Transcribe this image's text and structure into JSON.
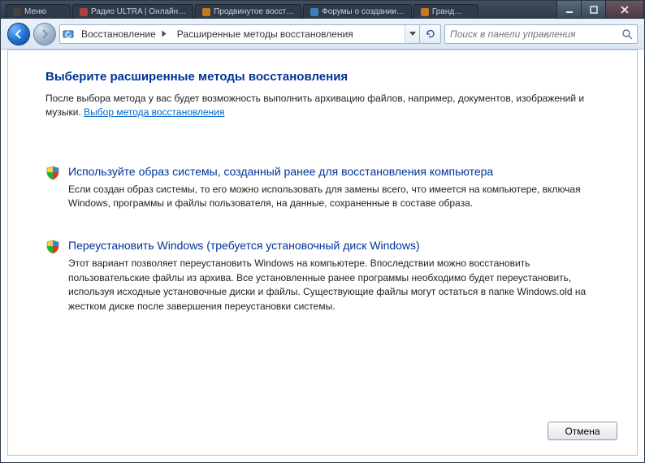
{
  "titlebar": {
    "tabs": [
      {
        "label": "Меню"
      },
      {
        "label": "Радио ULTRA | Онлайн…"
      },
      {
        "label": "Продвинутое восст…"
      },
      {
        "label": "Форумы о создании…"
      },
      {
        "label": "Гранд…"
      }
    ]
  },
  "nav": {
    "breadcrumb": [
      "Восстановление",
      "Расширенные методы восстановления"
    ],
    "search_placeholder": "Поиск в панели управления"
  },
  "page": {
    "title": "Выберите расширенные методы восстановления",
    "intro_prefix": "После выбора метода у вас будет возможность выполнить архивацию файлов, например, документов, изображений и музыки. ",
    "intro_link": "Выбор метода восстановления"
  },
  "options": [
    {
      "title": "Используйте образ системы, созданный ранее для восстановления компьютера",
      "desc": "Если создан образ системы, то его можно использовать для замены всего, что имеется на компьютере, включая Windows, программы и файлы пользователя, на данные, сохраненные в составе образа."
    },
    {
      "title": "Переустановить Windows (требуется установочный диск Windows)",
      "desc": "Этот вариант позволяет переустановить Windows на компьютере. Впоследствии можно восстановить пользовательские файлы из архива. Все установленные ранее программы необходимо будет переустановить, используя исходные установочные диски и файлы. Существующие файлы могут остаться в папке Windows.old на жестком диске после завершения переустановки системы."
    }
  ],
  "buttons": {
    "cancel": "Отмена"
  }
}
